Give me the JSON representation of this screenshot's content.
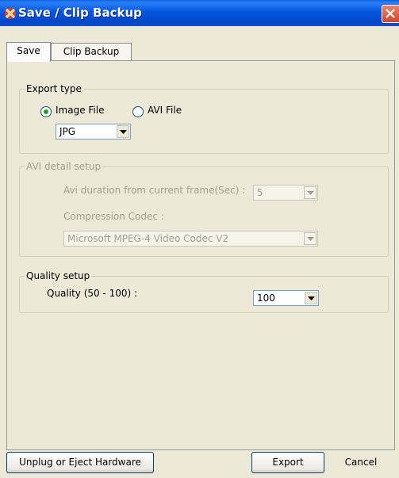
{
  "window": {
    "title": "Save / Clip Backup",
    "icon": "app-logo-icon",
    "close_icon": "close-icon"
  },
  "tabs": [
    {
      "label": "Save",
      "active": true
    },
    {
      "label": "Clip Backup",
      "active": false
    }
  ],
  "export_type": {
    "legend": "Export type",
    "options": [
      {
        "label": "Image File",
        "selected": true
      },
      {
        "label": "AVI File",
        "selected": false
      }
    ],
    "format_value": "JPG"
  },
  "avi_setup": {
    "legend": "AVI detail setup",
    "duration_label": "Avi duration from current frame(Sec) :",
    "duration_value": "5",
    "codec_label": "Compression Codec :",
    "codec_value": "Microsoft MPEG-4 Video Codec V2",
    "enabled": false
  },
  "quality_setup": {
    "legend": "Quality setup",
    "quality_label": "Quality (50 - 100) :",
    "quality_value": "100"
  },
  "buttons": {
    "eject": "Unplug or Eject Hardware",
    "export": "Export",
    "cancel": "Cancel"
  },
  "colors": {
    "titlebar": "#0556DC",
    "face": "#ECE9D8",
    "close": "#D0462E"
  }
}
